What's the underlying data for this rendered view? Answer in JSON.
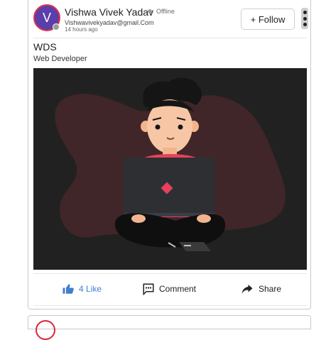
{
  "post": {
    "author": {
      "initial": "V",
      "name": "Vishwa Vivek Yadav",
      "status": "Offline",
      "email": "Vishwavivekyadav@gmail.Com",
      "time": "14 hours ago"
    },
    "follow_label": "+ Follow",
    "title": "WDS",
    "subtitle": "Web Developer",
    "image_icon": "developer-illustration",
    "actions": {
      "like_label": "4 Like",
      "comment_label": "Comment",
      "share_label": "Share"
    },
    "colors": {
      "avatar_bg": "#5b3ea9",
      "avatar_ring": "#e2324b",
      "like_blue": "#3f7fd0",
      "image_bg": "#212121"
    }
  }
}
